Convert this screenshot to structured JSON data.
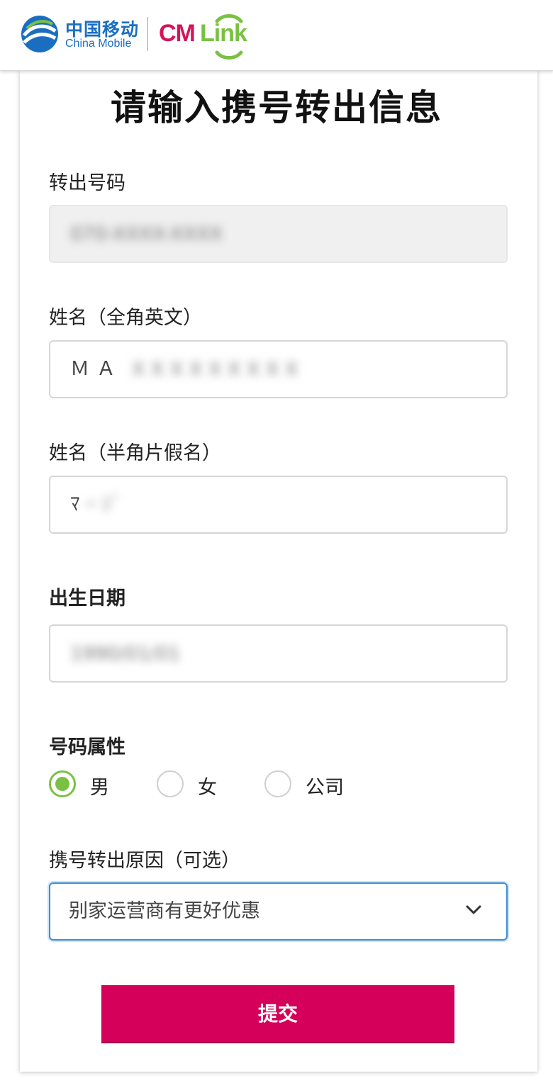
{
  "header": {
    "carrier_name_cn": "中国移动",
    "carrier_name_en": "China Mobile",
    "brand_cm": "CM",
    "brand_link": "Link",
    "colors": {
      "brand_pink": "#d4145a",
      "brand_green": "#7ac143",
      "carrier_blue": "#1a6ec2"
    }
  },
  "form": {
    "title": "请输入携号转出信息",
    "number": {
      "label": "转出号码",
      "value": "070-XXXX-XXXX"
    },
    "name_en": {
      "label": "姓名（全角英文）",
      "value_visible": "ＭＡ",
      "value_hidden": "ＸＸＸＸＸＸＸＸＸ"
    },
    "name_kana": {
      "label": "姓名（半角片假名）",
      "value_visible": "ﾏ",
      "value_hidden": "ｰ ｼﾞ"
    },
    "birthdate": {
      "label": "出生日期",
      "value": "1990/01/01"
    },
    "attribute": {
      "label": "号码属性",
      "options": [
        {
          "label": "男",
          "checked": true
        },
        {
          "label": "女",
          "checked": false
        },
        {
          "label": "公司",
          "checked": false
        }
      ]
    },
    "reason": {
      "label": "携号转出原因（可选）",
      "selected": "别家运营商有更好优惠"
    },
    "submit_label": "提交"
  }
}
